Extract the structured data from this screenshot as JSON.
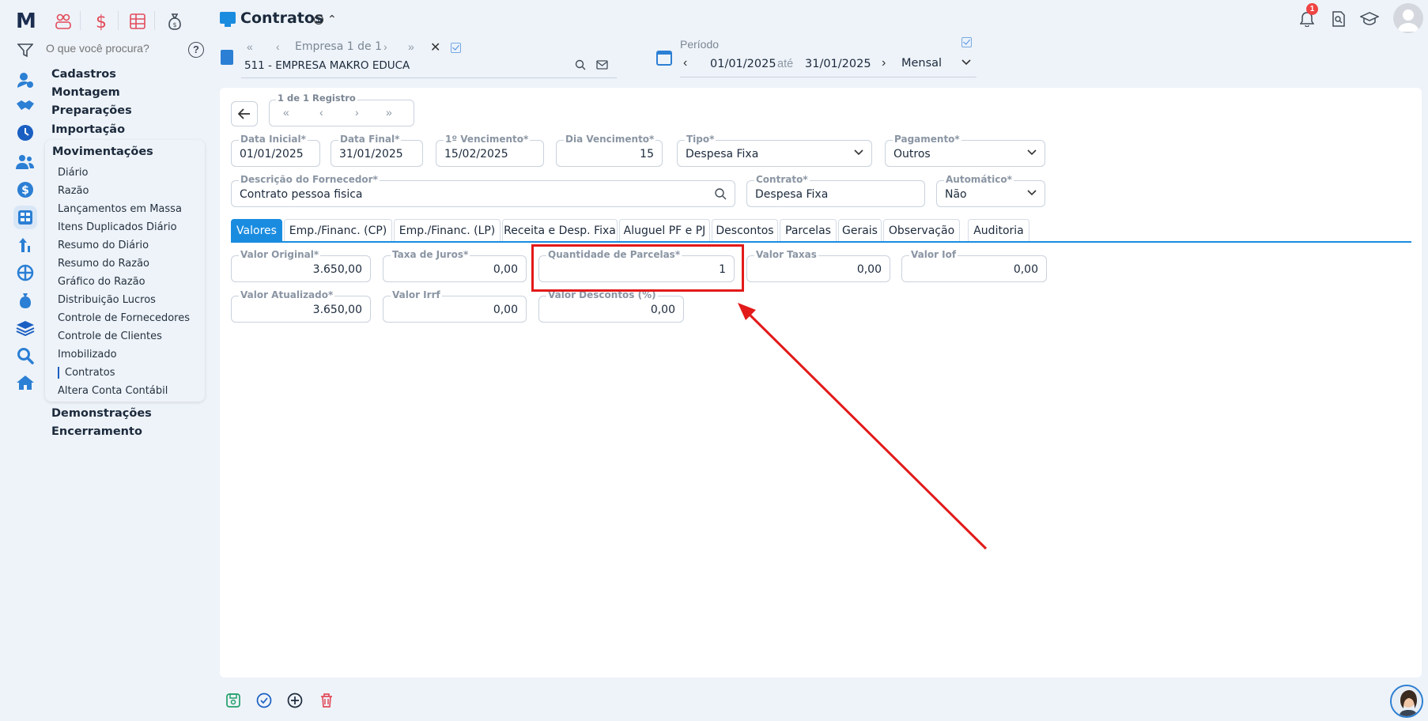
{
  "app": {
    "logo": "M",
    "search_placeholder": "O que você procura?",
    "help_label": "?"
  },
  "header": {
    "title": "Contratos",
    "info_glyph": "i",
    "empresa_nav_label": "Empresa 1 de 1",
    "empresa_name": "511 - EMPRESA MAKRO EDUCA",
    "periodo_label": "Período",
    "periodo_start": "01/01/2025",
    "periodo_sep": "até",
    "periodo_end": "31/01/2025",
    "periodo_mode": "Mensal",
    "notifications_count": "1"
  },
  "menu": {
    "top_items": [
      "Cadastros",
      "Montagem",
      "Preparações",
      "Importação"
    ],
    "group_title": "Movimentações",
    "group_items": [
      "Diário",
      "Razão",
      "Lançamentos em Massa",
      "Itens Duplicados Diário",
      "Resumo do Diário",
      "Resumo do Razão",
      "Gráfico do Razão",
      "Distribuição Lucros",
      "Controle de Fornecedores",
      "Controle de Clientes",
      "Imobilizado",
      "Contratos",
      "Altera Conta Contábil"
    ],
    "current_item": "Contratos",
    "bottom_items": [
      "Demonstrações",
      "Encerramento"
    ]
  },
  "record_nav": {
    "label": "1 de 1 Registro"
  },
  "form": {
    "data_inicial": {
      "label": "Data Inicial*",
      "value": "01/01/2025"
    },
    "data_final": {
      "label": "Data Final*",
      "value": "31/01/2025"
    },
    "vencimento": {
      "label": "1º Vencimento*",
      "value": "15/02/2025"
    },
    "dia_vencimento": {
      "label": "Dia Vencimento*",
      "value": "15"
    },
    "tipo": {
      "label": "Tipo*",
      "value": "Despesa Fixa"
    },
    "pagamento": {
      "label": "Pagamento*",
      "value": "Outros"
    },
    "fornecedor": {
      "label": "Descrição do Fornecedor*",
      "value": "Contrato pessoa fisica"
    },
    "contrato": {
      "label": "Contrato*",
      "value": "Despesa Fixa"
    },
    "automatico": {
      "label": "Automático*",
      "value": "Não"
    }
  },
  "tabs": [
    "Valores",
    "Emp./Financ. (CP)",
    "Emp./Financ. (LP)",
    "Receita e Desp. Fixa",
    "Aluguel PF e PJ",
    "Descontos",
    "Parcelas",
    "Gerais",
    "Observação",
    "Auditoria"
  ],
  "active_tab": "Valores",
  "valores": {
    "valor_original": {
      "label": "Valor Original*",
      "value": "3.650,00"
    },
    "taxa_juros": {
      "label": "Taxa de Juros*",
      "value": "0,00"
    },
    "qtd_parcelas": {
      "label": "Quantidade de Parcelas*",
      "value": "1"
    },
    "valor_taxas": {
      "label": "Valor Taxas",
      "value": "0,00"
    },
    "valor_iof": {
      "label": "Valor Iof",
      "value": "0,00"
    },
    "valor_atualizado": {
      "label": "Valor Atualizado*",
      "value": "3.650,00"
    },
    "valor_irrf": {
      "label": "Valor Irrf",
      "value": "0,00"
    },
    "valor_descontos": {
      "label": "Valor Descontos (%)",
      "value": "0,00"
    }
  },
  "colors": {
    "accent": "#1a8ce0",
    "highlight": "#e21a1a",
    "background": "#eef3f9"
  }
}
